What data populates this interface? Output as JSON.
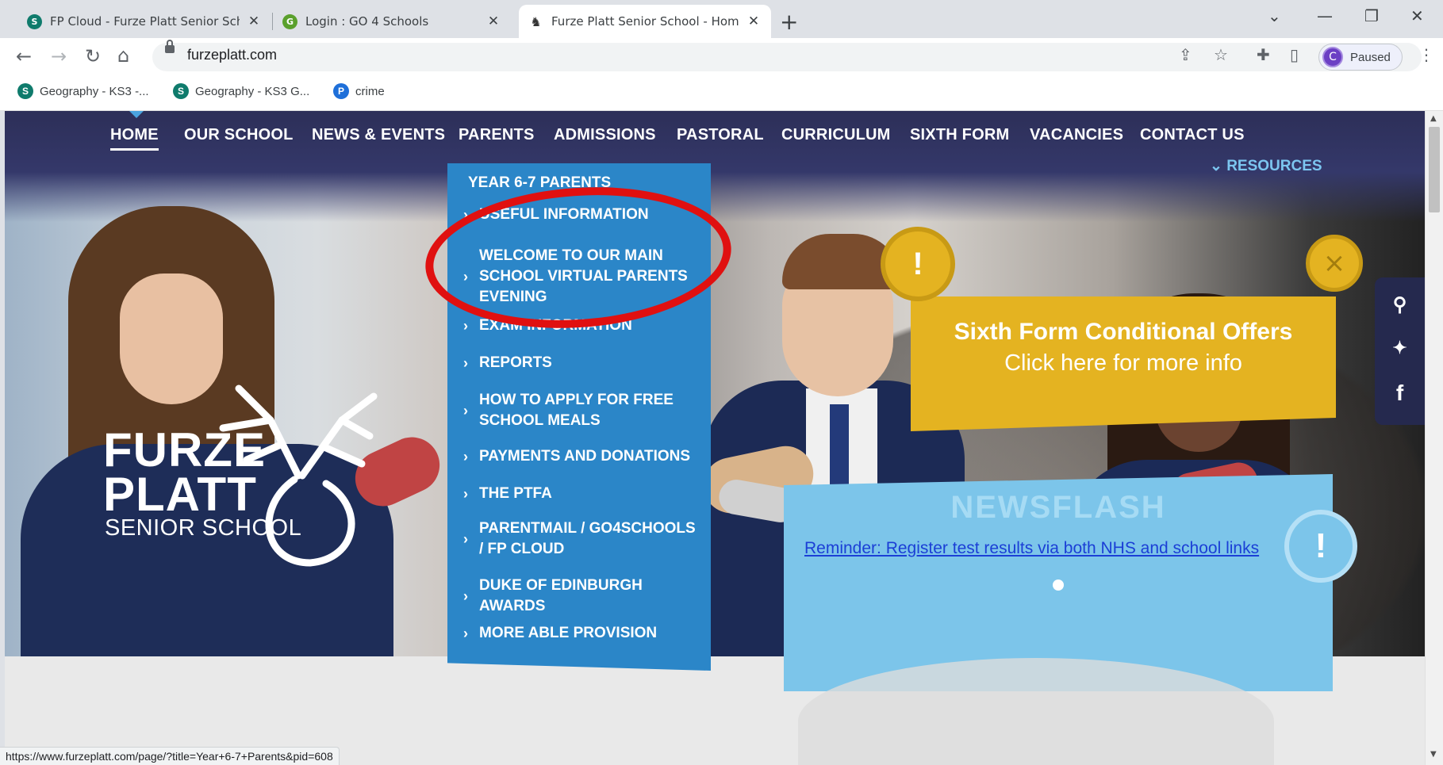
{
  "browser": {
    "tabs": [
      {
        "title": "FP Cloud - Furze Platt Senior Sch",
        "favicon": "sharepoint-icon",
        "color": "#0f7b6c"
      },
      {
        "title": "Login : GO 4 Schools",
        "favicon": "go4schools-icon",
        "color": "#5aa02c"
      },
      {
        "title": "Furze Platt Senior School - Home",
        "favicon": "stag-icon",
        "color": "#333333"
      }
    ],
    "new_tab": "+",
    "url": "furzeplatt.com",
    "profile": {
      "initial": "C",
      "status": "Paused"
    },
    "bookmarks": [
      {
        "label": "Geography - KS3 -...",
        "icon": "sharepoint-icon",
        "color": "#0f7b6c"
      },
      {
        "label": "Geography - KS3 G...",
        "icon": "sharepoint-icon",
        "color": "#0f7b6c"
      },
      {
        "label": "crime",
        "icon": "pinterest-icon",
        "color": "#1e6fd9"
      }
    ],
    "status_url": "https://www.furzeplatt.com/page/?title=Year+6-7+Parents&pid=608"
  },
  "site": {
    "nav": [
      {
        "label": "HOME",
        "active": true
      },
      {
        "label": "OUR SCHOOL"
      },
      {
        "label": "NEWS & EVENTS"
      },
      {
        "label": "PARENTS"
      },
      {
        "label": "ADMISSIONS"
      },
      {
        "label": "PASTORAL"
      },
      {
        "label": "CURRICULUM"
      },
      {
        "label": "SIXTH FORM"
      },
      {
        "label": "VACANCIES"
      },
      {
        "label": "CONTACT US"
      }
    ],
    "resources": "RESOURCES",
    "dropdown": {
      "heading": "YEAR 6-7 PARENTS",
      "items": [
        "USEFUL INFORMATION",
        "WELCOME TO OUR MAIN\nSCHOOL VIRTUAL PARENTS\nEVENING",
        "EXAM INFORMATION",
        "REPORTS",
        "HOW TO APPLY FOR FREE\nSCHOOL MEALS",
        "PAYMENTS AND DONATIONS",
        "THE PTFA",
        "PARENTMAIL / GO4SCHOOLS\n/ FP CLOUD",
        "DUKE OF EDINBURGH\nAWARDS",
        "MORE ABLE PROVISION"
      ]
    },
    "sixth_form_popup": {
      "title": "Sixth Form Conditional Offers",
      "subtitle": "Click here for more info",
      "alert": "!",
      "close": "×"
    },
    "newsflash": {
      "title": "NEWSFLASH",
      "link": "Reminder: Register test results via both NHS and school links",
      "alert": "!"
    },
    "logo": {
      "line1": "FURZE",
      "line2": "PLATT",
      "line3": "SENIOR SCHOOL"
    },
    "social": [
      "search-icon",
      "twitter-icon",
      "facebook-icon"
    ],
    "colors": {
      "nav_bg": "#2d2f58",
      "dropdown": "#2b86c8",
      "popup": "#e4b321",
      "newsflash": "#7cc5ea",
      "annotation": "#e01010"
    }
  }
}
